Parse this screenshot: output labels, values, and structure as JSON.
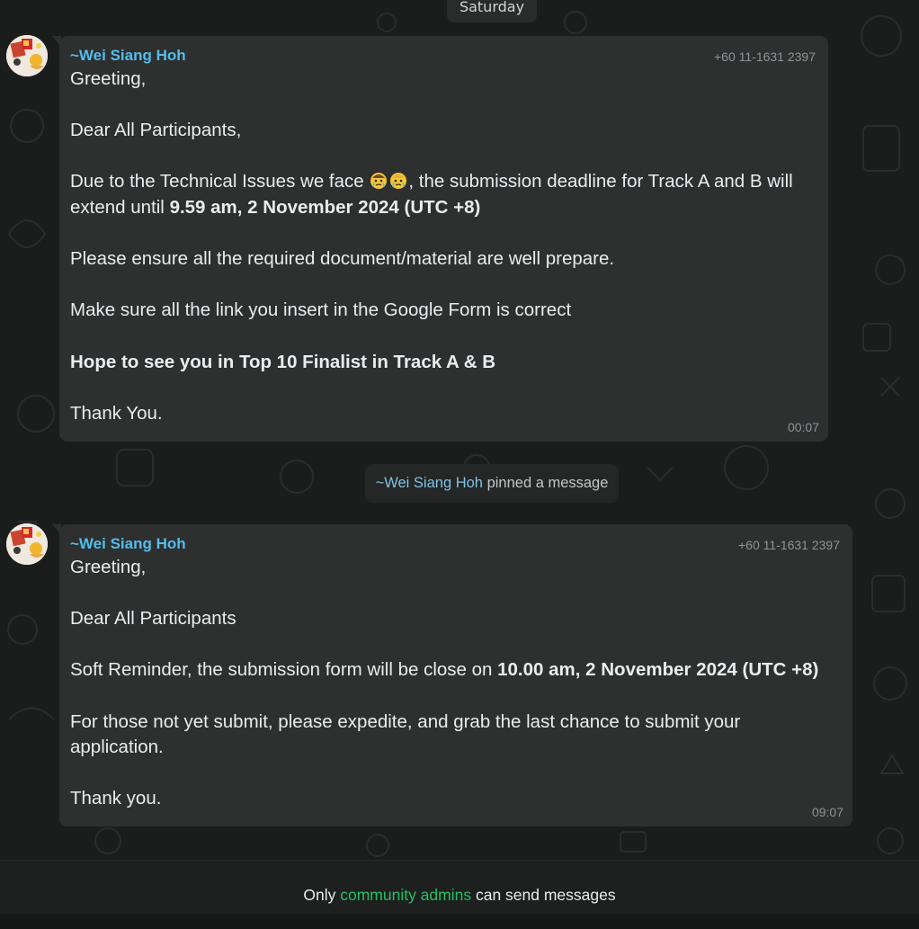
{
  "date_divider": "Saturday",
  "messages": [
    {
      "sender": "~Wei Siang Hoh",
      "phone": "+60 11-1631 2397",
      "time": "00:07",
      "lines": {
        "l1": "Greeting,",
        "l2": "Dear All Participants,",
        "l3a": "Due to the Technical Issues we face ",
        "l3b": ", the submission deadline for Track A and B will",
        "l4a": "extend until ",
        "l4b": "9.59 am, 2 November 2024 (UTC +8)",
        "l5": "Please ensure all the required document/material are well prepare.",
        "l6": "Make sure all the link you insert in the Google Form is correct",
        "l7": "Hope to see you in Top 10 Finalist in Track A & B",
        "l8": "Thank You."
      }
    },
    {
      "sender": "~Wei Siang Hoh",
      "phone": "+60 11-1631 2397",
      "time": "09:07",
      "lines": {
        "l1": "Greeting,",
        "l2": "Dear All Participants",
        "l3a": "Soft Reminder, the submission form will be close on ",
        "l3b": "10.00 am, 2 November 2024 (UTC +8)",
        "l4": "For those not yet submit, please expedite, and grab the last chance to submit your",
        "l5": "application.",
        "l6": "Thank you."
      }
    }
  ],
  "pin_notice": {
    "actor": "~Wei Siang Hoh",
    "action": " pinned a message"
  },
  "footer": {
    "prefix": "Only ",
    "highlight": "community admins",
    "suffix": " can send messages"
  },
  "colors": {
    "sender": "#53bdeb",
    "admins_link": "#21c063",
    "bubble": "#2e2f2f",
    "background": "#1b1c1c"
  },
  "icons": {
    "emoji": "crying-face-emoji",
    "avatar": "user-avatar"
  }
}
